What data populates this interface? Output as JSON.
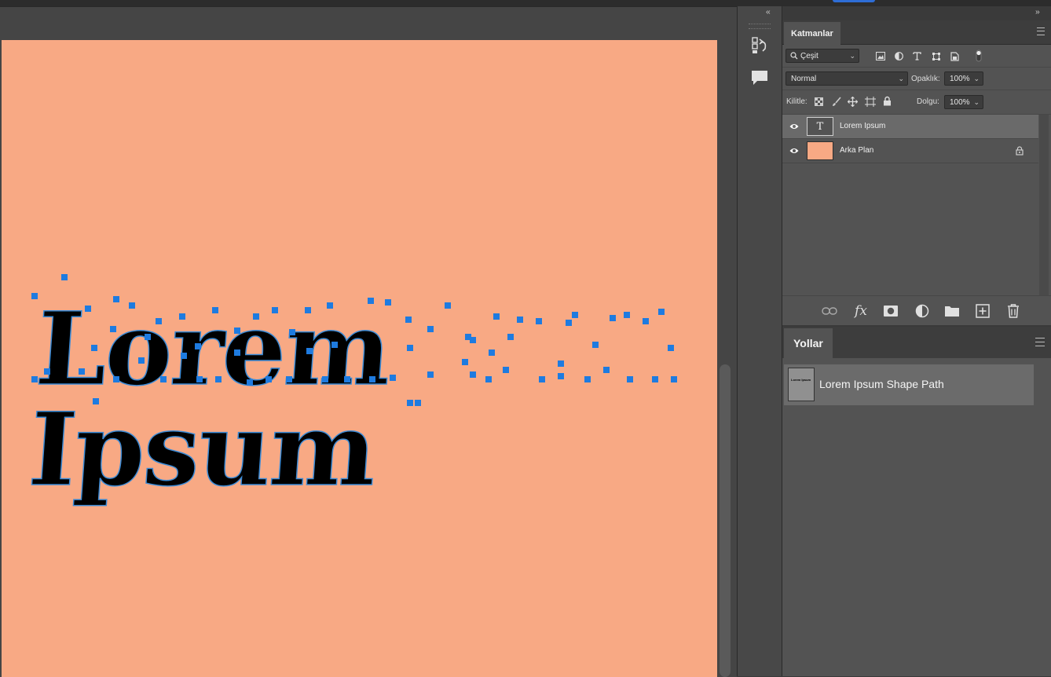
{
  "canvas": {
    "text": "Lorem Ipsum",
    "background_color": "#f8a984",
    "anchor_color": "#1e7be0"
  },
  "panel_toggles": {
    "collapse_left": "‹‹",
    "collapse_right": "››"
  },
  "layers_panel": {
    "tab_label": "Katmanlar",
    "filter_value": "Çeşit",
    "blend_mode": "Normal",
    "opacity_label": "Opaklık:",
    "opacity_value": "100%",
    "lock_label": "Kilitle:",
    "fill_label": "Dolgu:",
    "fill_value": "100%",
    "layers": [
      {
        "name": "Lorem Ipsum",
        "thumb_glyph": "T",
        "selected": true
      },
      {
        "name": "Arka Plan",
        "thumb_color": "#f8a984",
        "locked": true
      }
    ]
  },
  "paths_panel": {
    "tab_label": "Yollar",
    "paths": [
      {
        "name": "Lorem Ipsum Shape Path",
        "thumb_text": "Lorem Ipsum"
      }
    ]
  },
  "icons": [
    "history-icon",
    "comment-icon",
    "search-icon",
    "image-filter-icon",
    "adjustment-filter-icon",
    "type-filter-icon",
    "shape-filter-icon",
    "smart-object-filter-icon",
    "filter-toggle-icon",
    "lock-transparent-icon",
    "lock-brush-icon",
    "lock-move-icon",
    "lock-artboard-icon",
    "lock-all-icon",
    "eye-icon",
    "link-icon",
    "fx-icon",
    "mask-icon",
    "adjustment-icon",
    "folder-icon",
    "new-layer-icon",
    "trash-icon",
    "menu-icon"
  ]
}
